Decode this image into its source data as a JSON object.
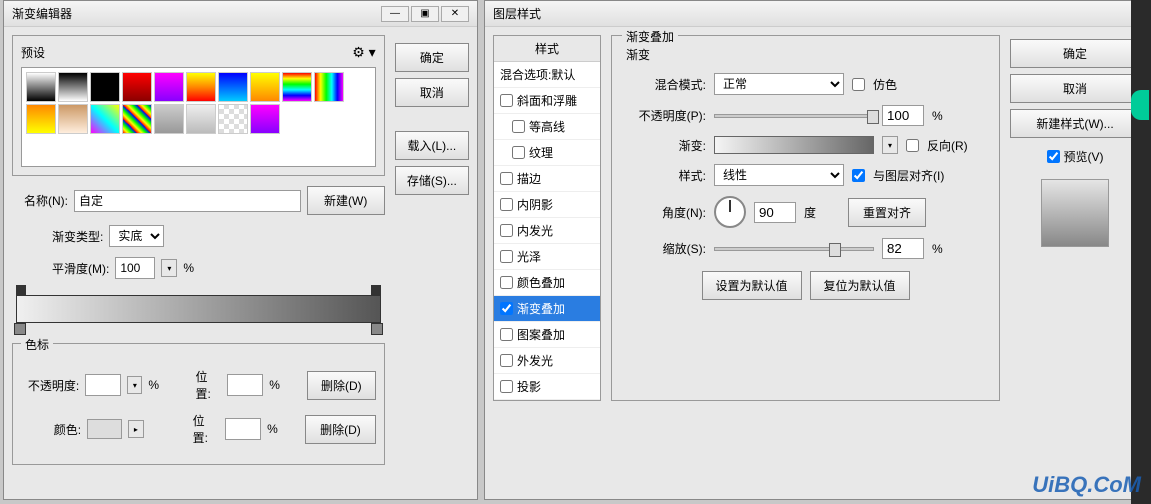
{
  "gradient_editor": {
    "title": "渐变编辑器",
    "presets_label": "预设",
    "buttons": {
      "ok": "确定",
      "cancel": "取消",
      "load": "载入(L)...",
      "save": "存储(S)..."
    },
    "name_label": "名称(N):",
    "name_value": "自定",
    "new_btn": "新建(W)",
    "gradient_type_label": "渐变类型:",
    "gradient_type_value": "实底",
    "smoothness_label": "平滑度(M):",
    "smoothness_value": "100",
    "smoothness_unit": "%",
    "stops_label": "色标",
    "opacity_label": "不透明度:",
    "opacity_unit": "%",
    "position_label": "位置:",
    "position_unit": "%",
    "delete_btn": "删除(D)",
    "color_label": "颜色:"
  },
  "layer_style": {
    "title": "图层样式",
    "styles_header": "样式",
    "blend_options": "混合选项:默认",
    "effects": {
      "bevel": "斜面和浮雕",
      "contour": "等高线",
      "texture": "纹理",
      "stroke": "描边",
      "inner_shadow": "内阴影",
      "inner_glow": "内发光",
      "satin": "光泽",
      "color_overlay": "颜色叠加",
      "gradient_overlay": "渐变叠加",
      "pattern_overlay": "图案叠加",
      "outer_glow": "外发光",
      "drop_shadow": "投影"
    },
    "panel_title": "渐变叠加",
    "subtitle": "渐变",
    "blend_mode_label": "混合模式:",
    "blend_mode_value": "正常",
    "dither_label": "仿色",
    "opacity_label": "不透明度(P):",
    "opacity_value": "100",
    "percent": "%",
    "gradient_label": "渐变:",
    "reverse_label": "反向(R)",
    "style_label": "样式:",
    "style_value": "线性",
    "align_label": "与图层对齐(I)",
    "angle_label": "角度(N):",
    "angle_value": "90",
    "angle_unit": "度",
    "reset_align": "重置对齐",
    "scale_label": "缩放(S):",
    "scale_value": "82",
    "set_default": "设置为默认值",
    "reset_default": "复位为默认值",
    "buttons": {
      "ok": "确定",
      "cancel": "取消",
      "new_style": "新建样式(W)..."
    },
    "preview_label": "预览(V)"
  },
  "watermark": "UiBQ.CoM"
}
